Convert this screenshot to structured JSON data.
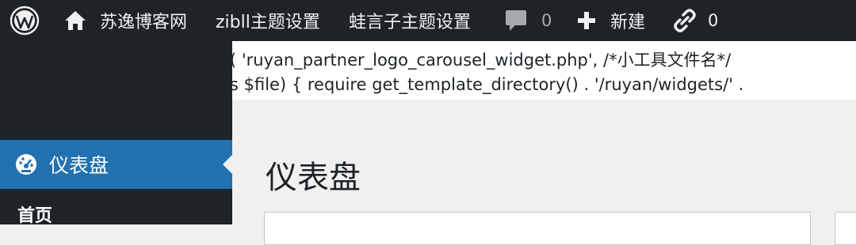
{
  "admin_bar": {
    "wp_logo_icon": "wordpress-logo",
    "site_icon": "home-icon",
    "site_name": "苏逸博客网",
    "theme_settings": "zibll主题设置",
    "custom_settings": "蛙言子主题设置",
    "comments_icon": "comment-bubble-icon",
    "comments_count": "0",
    "new_icon": "plus-icon",
    "new_label": "新建",
    "links_icon": "chain-link-icon",
    "links_count": "0"
  },
  "notice": {
    "line1": "( 'ruyan_partner_logo_carousel_widget.php', /*小工具文件名*/",
    "line2": "s $file) { require get_template_directory() . '/ruyan/widgets/' ."
  },
  "sidebar": {
    "current_item": {
      "icon": "dashboard-gauge-icon",
      "label": "仪表盘"
    },
    "submenu_first": "首页"
  },
  "page": {
    "title": "仪表盘"
  },
  "colors": {
    "admin_bar_bg": "#1d2327",
    "menu_current_bg": "#2271b1",
    "content_bg": "#f0f0f1"
  }
}
